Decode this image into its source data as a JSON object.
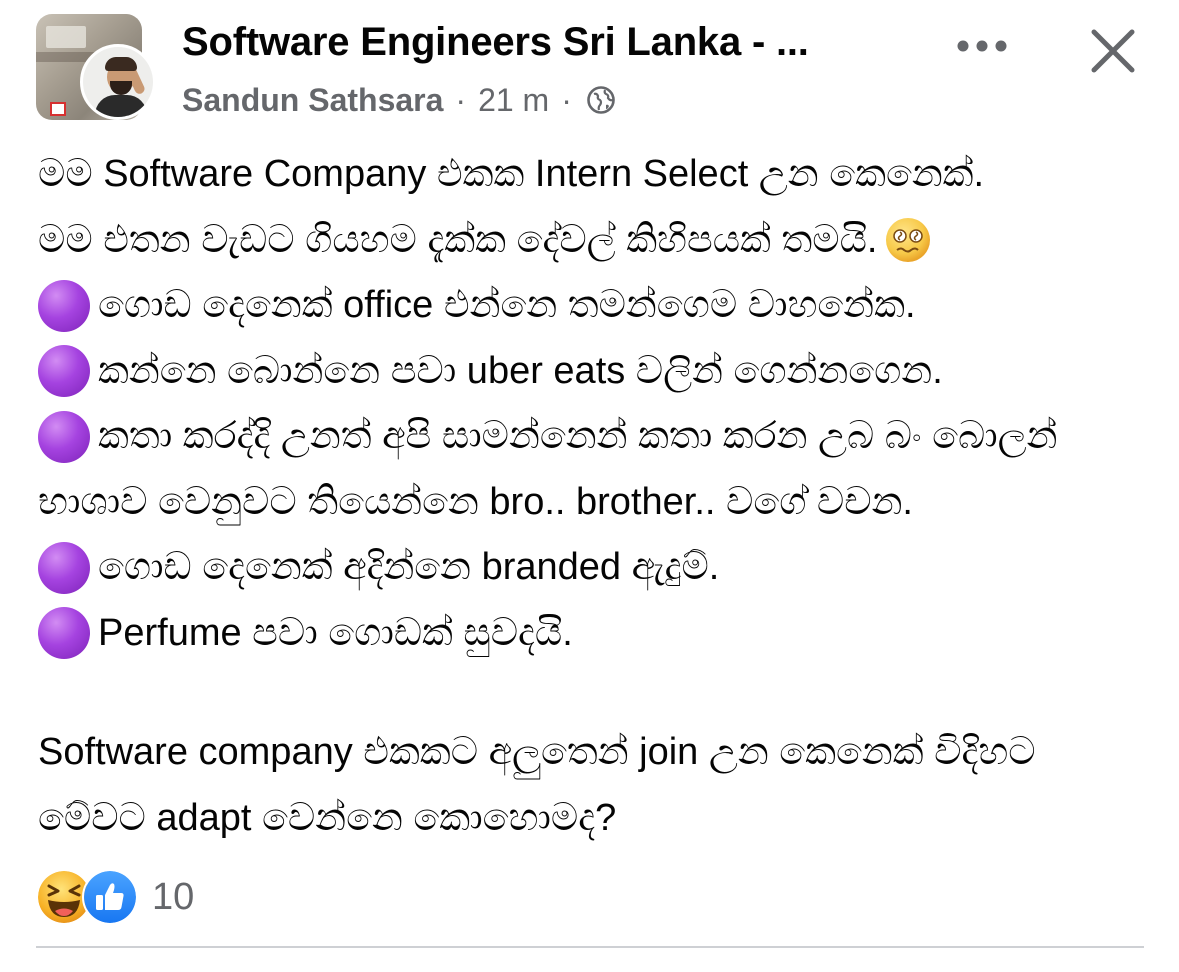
{
  "header": {
    "group_name": "Software Engineers Sri Lanka - ...",
    "author": "Sandun Sathsara",
    "separator": "·",
    "time": "21 m",
    "privacy_icon": "globe-icon",
    "more_icon": "more-horizontal-icon",
    "close_icon": "close-icon"
  },
  "post": {
    "lines": [
      {
        "bullet": false,
        "text": "මම Software Company එකක Intern Select උන කෙනෙක්."
      },
      {
        "bullet": false,
        "text": "මම එතන වැඩට ගියහම දැක්ක දේවල් කිහිපයක් තමයි.",
        "emoji": "woozy-face-icon"
      },
      {
        "bullet": true,
        "text": "ගොඩ දෙනෙක් office එන්නෙ තමන්ගෙම වාහනේක."
      },
      {
        "bullet": true,
        "text": "කන්නෙ බොන්නෙ පවා uber eats වලින් ගෙන්නගෙන."
      },
      {
        "bullet": true,
        "text": "කතා කරද්දි උනත් අපි සාමන්නෙන් කතා කරන උබ බං බොලන්"
      },
      {
        "bullet": false,
        "text": "භාශාව වෙනුවට තියෙන්නෙ bro.. brother.. වගේ වචන."
      },
      {
        "bullet": true,
        "text": "ගොඩ දෙනෙක් අදින්නෙ branded ඇදුම්."
      },
      {
        "bullet": true,
        "text": "Perfume පවා ගොඩක් සුවදයි."
      },
      {
        "bullet": false,
        "text": ""
      },
      {
        "bullet": false,
        "text": "Software company එකකට අලුතෙන් join උන කෙනෙක් විදිහට"
      },
      {
        "bullet": false,
        "text": "මේවට adapt වෙන්නෙ කොහොමද?"
      }
    ],
    "bullet_icon": "purple-circle-icon",
    "bullet_color": "#a543e0"
  },
  "reactions": {
    "icons": [
      "laughing-face-icon",
      "like-thumbs-up-icon"
    ],
    "count": "10",
    "like_color": "#1877f2",
    "haha_color": "#f7b125"
  }
}
